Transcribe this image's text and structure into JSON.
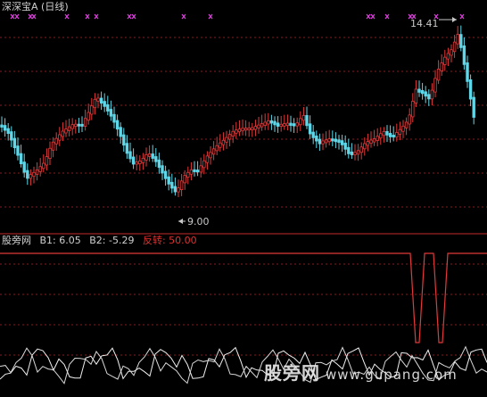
{
  "header": {
    "title": "深深宝A (日线)"
  },
  "price_labels": {
    "high": "14.41",
    "low": "9.00"
  },
  "indicator": {
    "name": "股旁网",
    "b1": "B1: 6.05",
    "b2": "B2: -5.29",
    "fanzhuan_label": "反转: 50.00"
  },
  "watermark": {
    "text": "股旁网",
    "url": "www.gupang.com"
  },
  "colors": {
    "background": "#000000",
    "up_candle": "#e03a3a",
    "down_candle": "#5fd7e8",
    "grid_dotted": "#8a1a1a",
    "pane_divider": "#c42a2a",
    "marker_magenta": "#e040e0",
    "signal_line": "#e03a3a",
    "osc_line": "#f0f0f0"
  },
  "chart_data": {
    "type": "candlestick",
    "title": "深深宝A (日线)",
    "highest_price": 14.41,
    "lowest_price": 9.0,
    "indicator_values": {
      "B1": 6.05,
      "B2": -5.29,
      "反转": 50.0
    }
  }
}
